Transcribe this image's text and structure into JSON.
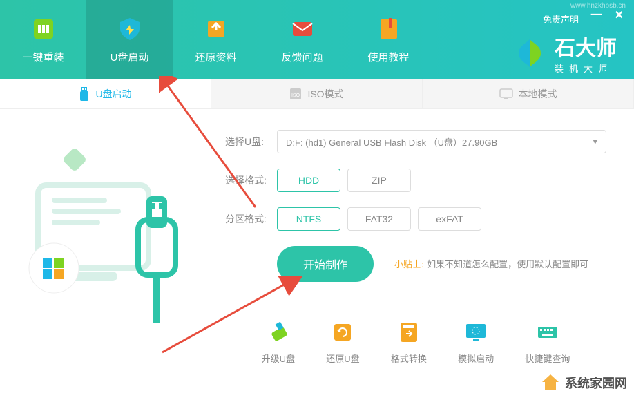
{
  "header": {
    "disclaimer": "免责声明",
    "nav": [
      {
        "label": "一键重装"
      },
      {
        "label": "U盘启动"
      },
      {
        "label": "还原资料"
      },
      {
        "label": "反馈问题"
      },
      {
        "label": "使用教程"
      }
    ],
    "logo_main": "石大师",
    "logo_sub": "装机大师"
  },
  "tabs": [
    {
      "label": "U盘启动"
    },
    {
      "label": "ISO模式"
    },
    {
      "label": "本地模式"
    }
  ],
  "form": {
    "usb_label": "选择U盘:",
    "usb_value": "D:F: (hd1) General USB Flash Disk （U盘）27.90GB",
    "format_label": "选择格式:",
    "format_options": [
      "HDD",
      "ZIP"
    ],
    "partition_label": "分区格式:",
    "partition_options": [
      "NTFS",
      "FAT32",
      "exFAT"
    ],
    "start_btn": "开始制作",
    "tip_label": "小贴士:",
    "tip_text": "如果不知道怎么配置，使用默认配置即可"
  },
  "tools": [
    {
      "label": "升级U盘"
    },
    {
      "label": "还原U盘"
    },
    {
      "label": "格式转换"
    },
    {
      "label": "模拟启动"
    },
    {
      "label": "快捷键查询"
    }
  ],
  "watermarks": {
    "home": "系统家园网",
    "top_url": "www.hnzkhbsb.cn"
  }
}
